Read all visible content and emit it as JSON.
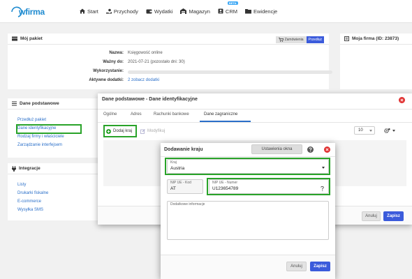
{
  "brand": {
    "name": "wfirma"
  },
  "nav": {
    "start": "Start",
    "przychody": "Przychody",
    "wydatki": "Wydatki",
    "magazyn": "Magazyn",
    "crm": "CRM",
    "crm_badge": "BETA",
    "ewidencje": "Ewidencje"
  },
  "package": {
    "title": "Mój pakiet",
    "orders_button": "Zamówienia",
    "extend_button": "Przedłuż",
    "rows": [
      {
        "label": "Nazwa:",
        "value": "Księgowość online"
      },
      {
        "label": "Ważny do:",
        "value": "2021-07-21 (pozostało dni: 30)"
      },
      {
        "label": "Wykorzystanie:"
      },
      {
        "label": "Aktywne dodatki:",
        "value": "2 zobacz dodatki"
      }
    ]
  },
  "company": {
    "title": "Moja firma (ID: 23873)"
  },
  "basic_data": {
    "title": "Dane podstawowe",
    "links": [
      "Przedłuż pakiet",
      "Dane identyfikacyjne",
      "Rodzaj firmy i właściciele",
      "Zarządzanie interfejsem"
    ]
  },
  "integrations": {
    "title": "Integracje",
    "links": [
      "Listy",
      "Drukarki fiskalne",
      "E-commerce",
      "Wysyłka SMS"
    ]
  },
  "dialog_identification": {
    "title": "Dane podstawowe - Dane identyfikacyjne",
    "tabs": [
      "Ogólne",
      "Adres",
      "Rachunki bankowe",
      "Dane zagraniczne"
    ],
    "active_tab": "Dane zagraniczne",
    "add_country": "Dodaj kraj",
    "modify": "Modyfikuj",
    "per_page": "10",
    "cancel": "Anuluj",
    "save": "Zapisz"
  },
  "dialog_country": {
    "title": "Dodawanie kraju",
    "window_settings": "Ustawienia okna",
    "country_label": "Kraj",
    "country_value": "Austria",
    "vat_code_label": "NIP UE - Kod",
    "vat_code_value": "AT",
    "vat_number_label": "NIP UE - Numer",
    "vat_number_value": "U123654789",
    "extra_info_label": "Dodatkowe informacje",
    "cancel": "Anuluj",
    "save": "Zapisz"
  },
  "colors": {
    "primary": "#3b5bdb",
    "link": "#2a6fc9",
    "highlight": "#29a329",
    "danger": "#e03131"
  }
}
